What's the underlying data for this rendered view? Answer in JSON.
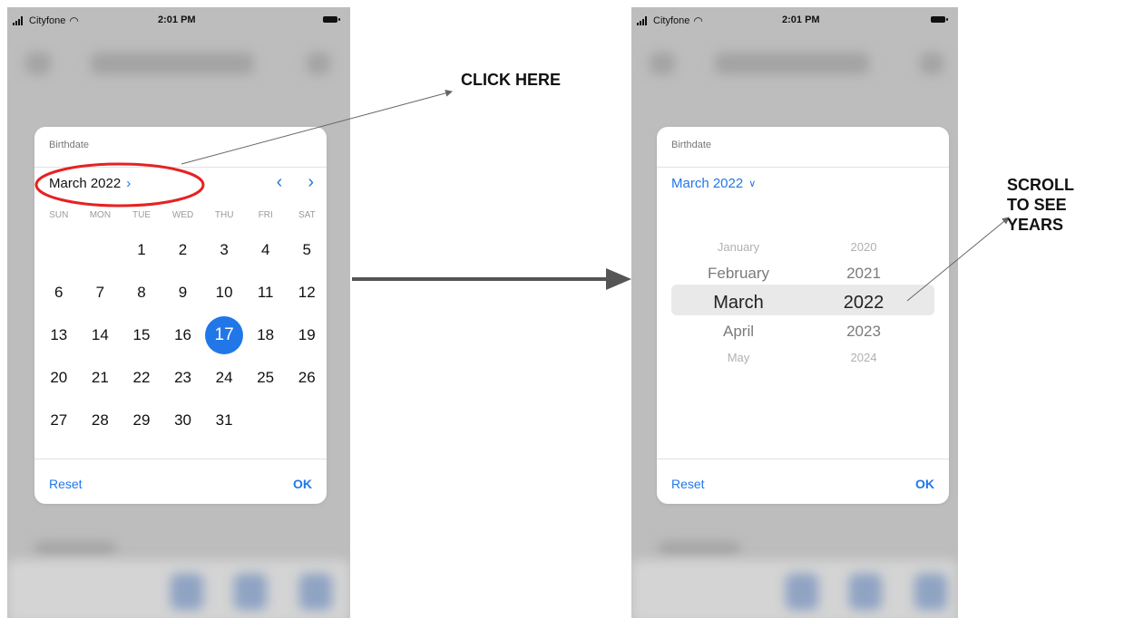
{
  "status_bar": {
    "carrier": "Cityfone",
    "time": "2:01 PM"
  },
  "left_dialog": {
    "title": "Birthdate",
    "month_label": "March 2022",
    "weekdays": [
      "SUN",
      "MON",
      "TUE",
      "WED",
      "THU",
      "FRI",
      "SAT"
    ],
    "weeks": [
      [
        "",
        "",
        "1",
        "2",
        "3",
        "4",
        "5"
      ],
      [
        "6",
        "7",
        "8",
        "9",
        "10",
        "11",
        "12"
      ],
      [
        "13",
        "14",
        "15",
        "16",
        "17",
        "18",
        "19"
      ],
      [
        "20",
        "21",
        "22",
        "23",
        "24",
        "25",
        "26"
      ],
      [
        "27",
        "28",
        "29",
        "30",
        "31",
        "",
        ""
      ]
    ],
    "selected_day": "17",
    "reset_label": "Reset",
    "ok_label": "OK"
  },
  "right_dialog": {
    "title": "Birthdate",
    "month_label": "March 2022",
    "months": [
      "January",
      "February",
      "March",
      "April",
      "May"
    ],
    "years": [
      "2020",
      "2021",
      "2022",
      "2023",
      "2024"
    ],
    "selected_month": "March",
    "selected_year": "2022",
    "reset_label": "Reset",
    "ok_label": "OK"
  },
  "annotations": {
    "click_here": "CLICK HERE",
    "scroll_lines": [
      "SCROLL",
      "TO SEE",
      "YEARS"
    ]
  },
  "colors": {
    "accent": "#2177e8",
    "highlight": "#e52222",
    "background_blur": "#bdbdbd"
  }
}
